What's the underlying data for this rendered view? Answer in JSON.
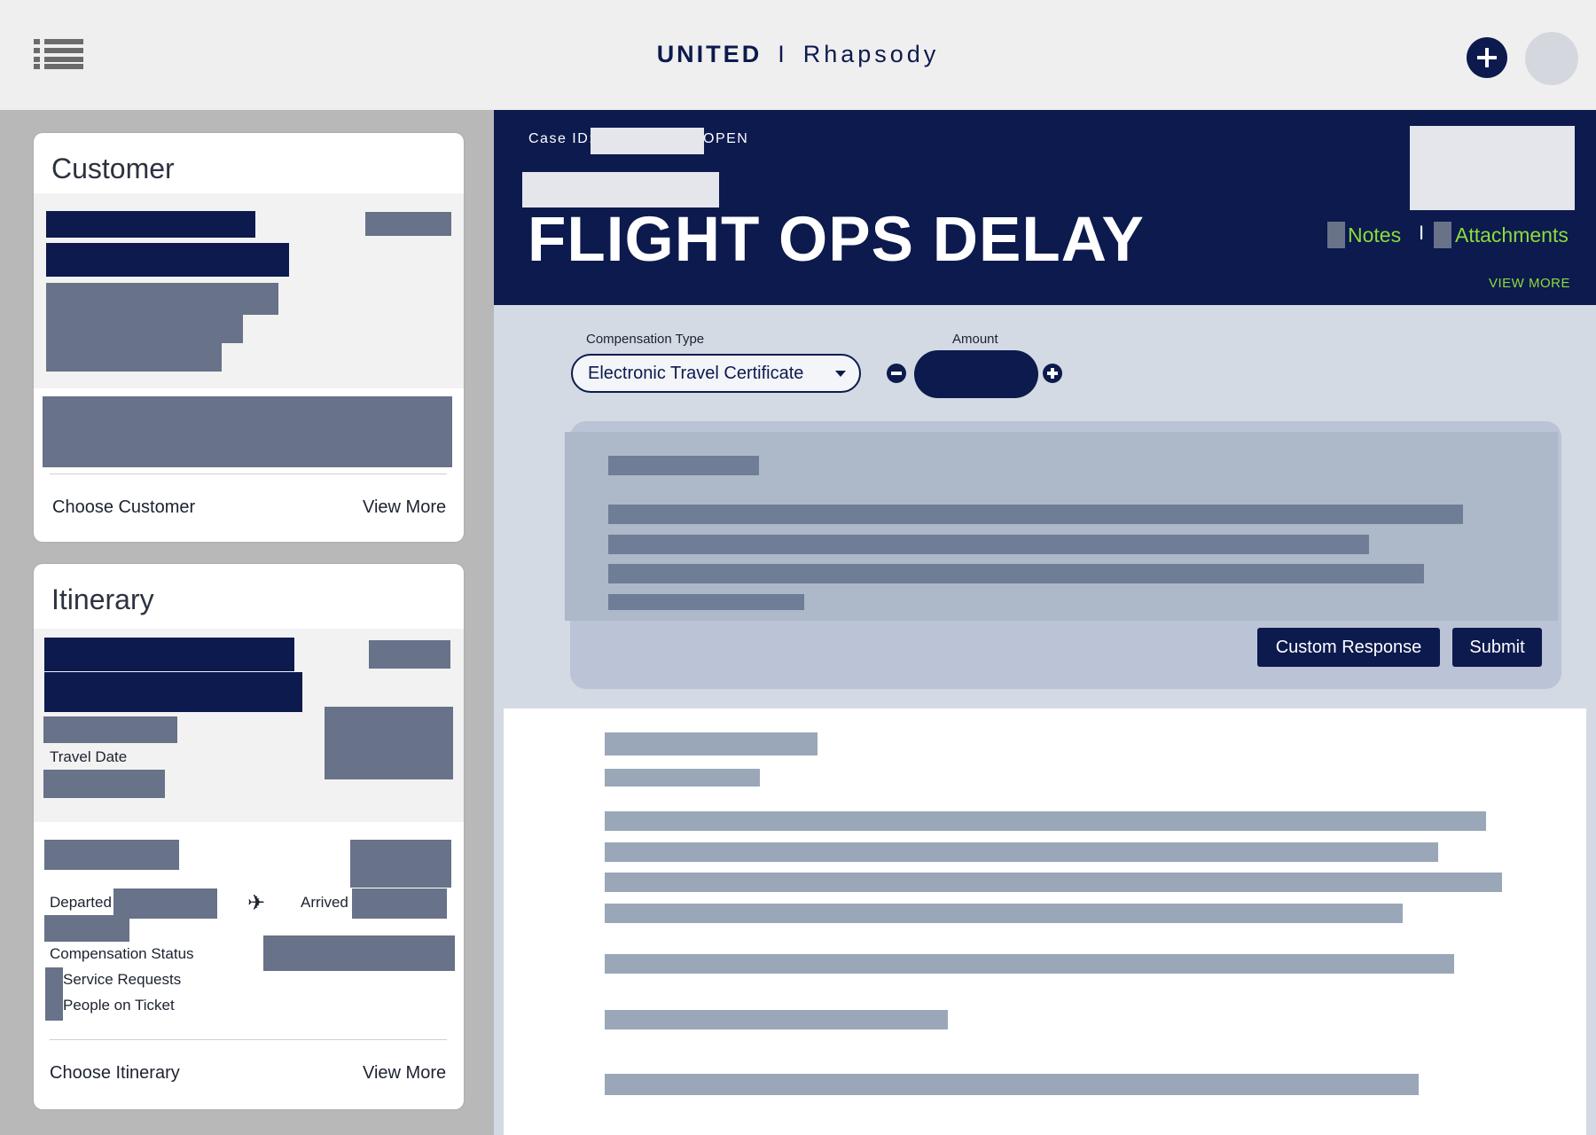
{
  "topbar": {
    "brand_primary": "UNITED",
    "brand_separator": "I",
    "brand_secondary": "Rhapsody",
    "menu_icon": "hamburger-menu-icon",
    "add_icon": "plus-icon"
  },
  "customer_card": {
    "title": "Customer",
    "choose_label": "Choose Customer",
    "view_more_label": "View More"
  },
  "itinerary_card": {
    "title": "Itinerary",
    "travel_date_label": "Travel Date",
    "departed_label": "Departed",
    "arrived_label": "Arrived",
    "plane_icon": "airplane-icon",
    "compensation_status_label": "Compensation Status",
    "service_requests_label": "Service Requests",
    "people_on_ticket_label": "People on Ticket",
    "choose_label": "Choose Itinerary",
    "view_more_label": "View More"
  },
  "case": {
    "id_label": "Case ID:",
    "status": "OPEN",
    "title": "FLIGHT OPS DELAY",
    "notes_label": "Notes",
    "link_separator": "I",
    "attachments_label": "Attachments",
    "view_more_label": "VIEW MORE"
  },
  "compensation": {
    "type_label": "Compensation Type",
    "type_value": "Electronic Travel Certificate",
    "amount_label": "Amount"
  },
  "actions": {
    "custom_response_label": "Custom Response",
    "submit_label": "Submit"
  },
  "colors": {
    "navy": "#0c1a4e",
    "accent_green": "#8ddb3a",
    "redaction_slate": "#687289",
    "panel_bg": "#d3dae3"
  }
}
